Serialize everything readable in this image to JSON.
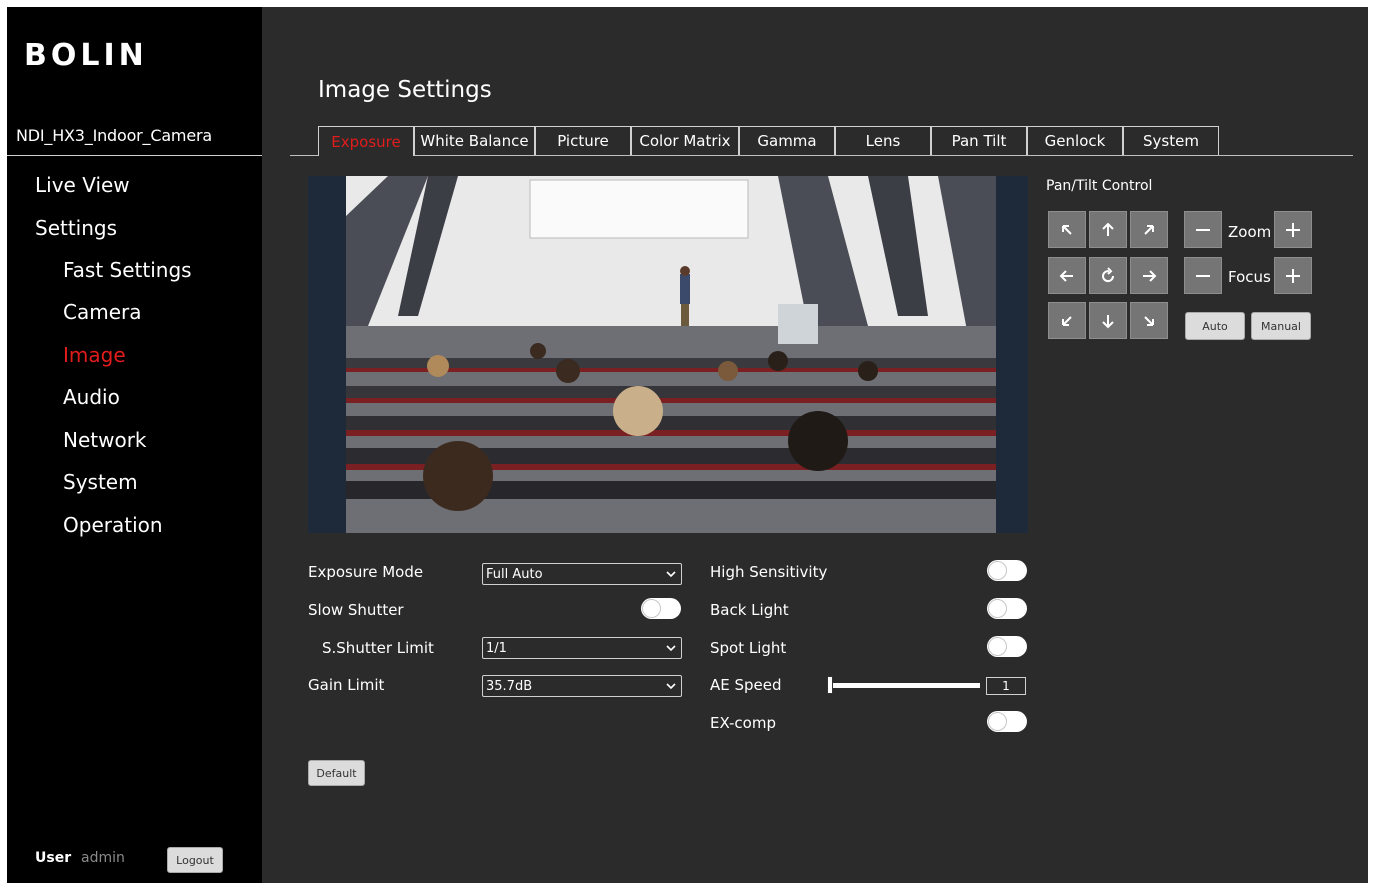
{
  "sidebar": {
    "brand": "BOLIN",
    "device_name": "NDI_HX3_Indoor_Camera",
    "nav": {
      "live_view": "Live View",
      "settings": "Settings",
      "fast_settings": "Fast Settings",
      "camera": "Camera",
      "image": "Image",
      "audio": "Audio",
      "network": "Network",
      "system": "System",
      "operation": "Operation"
    },
    "user_label": "User",
    "user_name": "admin",
    "logout": "Logout"
  },
  "main": {
    "title": "Image Settings",
    "tabs": [
      "Exposure",
      "White Balance",
      "Picture",
      "Color Matrix",
      "Gamma",
      "Lens",
      "Pan Tilt",
      "Genlock",
      "System"
    ],
    "active_tab": "Exposure"
  },
  "exposure": {
    "exposure_mode": {
      "label": "Exposure Mode",
      "value": "Full Auto"
    },
    "slow_shutter": {
      "label": "Slow Shutter",
      "on": false
    },
    "s_shutter_limit": {
      "label": "S.Shutter Limit",
      "value": "1/1"
    },
    "gain_limit": {
      "label": "Gain Limit",
      "value": "35.7dB"
    },
    "high_sensitivity": {
      "label": "High Sensitivity",
      "on": false
    },
    "back_light": {
      "label": "Back Light",
      "on": false
    },
    "spot_light": {
      "label": "Spot Light",
      "on": false
    },
    "ae_speed": {
      "label": "AE Speed",
      "value": "1"
    },
    "ex_comp": {
      "label": "EX-comp",
      "on": false
    },
    "default_button": "Default"
  },
  "pan_tilt": {
    "title": "Pan/Tilt Control",
    "zoom_label": "Zoom",
    "focus_label": "Focus",
    "auto_button": "Auto",
    "manual_button": "Manual"
  },
  "colors": {
    "accent": "#e21b1b",
    "sidebar_bg": "#000000",
    "main_bg": "#2b2b2b",
    "control_btn": "#757575"
  }
}
